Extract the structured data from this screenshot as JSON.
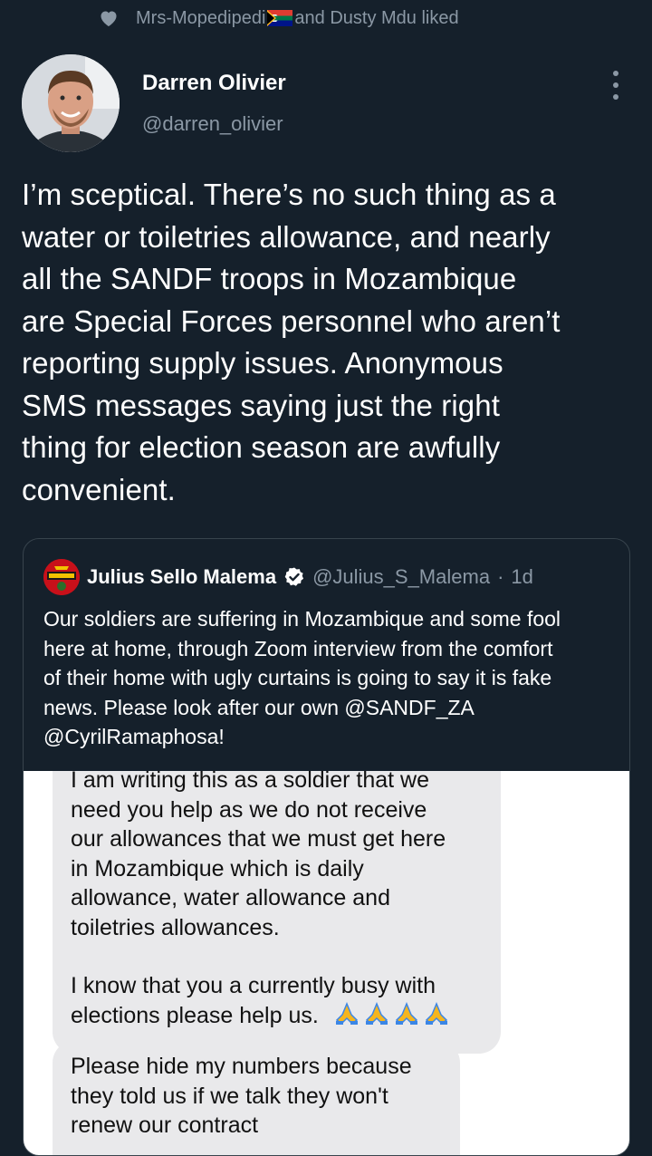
{
  "social_context": {
    "user1": "Mrs-Mopedipedi",
    "rest": " and Dusty Mdu liked",
    "icon": "heart-icon"
  },
  "tweet": {
    "author_name": "Darren Olivier",
    "author_handle": "@darren_olivier",
    "more_icon": "more-vertical-icon",
    "text_lines": [
      "I’m sceptical. There’s no such thing as a",
      "water or toiletries allowance, and nearly",
      "all the SANDF troops in Mozambique",
      "are Special Forces personnel who aren’t",
      "reporting supply issues. Anonymous",
      "SMS messages saying just the right",
      "thing for election season are awfully",
      "convenient."
    ]
  },
  "quote": {
    "author_name": "Julius Sello Malema",
    "author_handle": "@Julius_S_Malema",
    "separator": "·",
    "time": "1d",
    "text_lines": [
      "Our soldiers are suffering in Mozambique and some fool",
      "here at home, through Zoom interview from the comfort",
      "of their home with ugly curtains is going to say it is fake",
      "news. Please look after our own @SANDF_ZA",
      "@CyrilRamaphosa!"
    ],
    "image": {
      "bubble1_lines": [
        "I am writing this as a soldier that we",
        "need you help as we do not receive",
        "our allowances that we must get here",
        "in Mozambique which is daily",
        "allowance, water allowance and",
        "toiletries allowances."
      ],
      "bubble1_lines2": [
        "I know that you a currently busy with",
        "elections please help us."
      ],
      "bubble2_lines": [
        "Please hide my numbers because",
        "they told us if we talk they won't",
        "renew our contract"
      ]
    }
  },
  "colors": {
    "background": "#15202b",
    "secondary_text": "#8b98a5",
    "border": "#38444d",
    "verified_blue": "#ffffff"
  }
}
